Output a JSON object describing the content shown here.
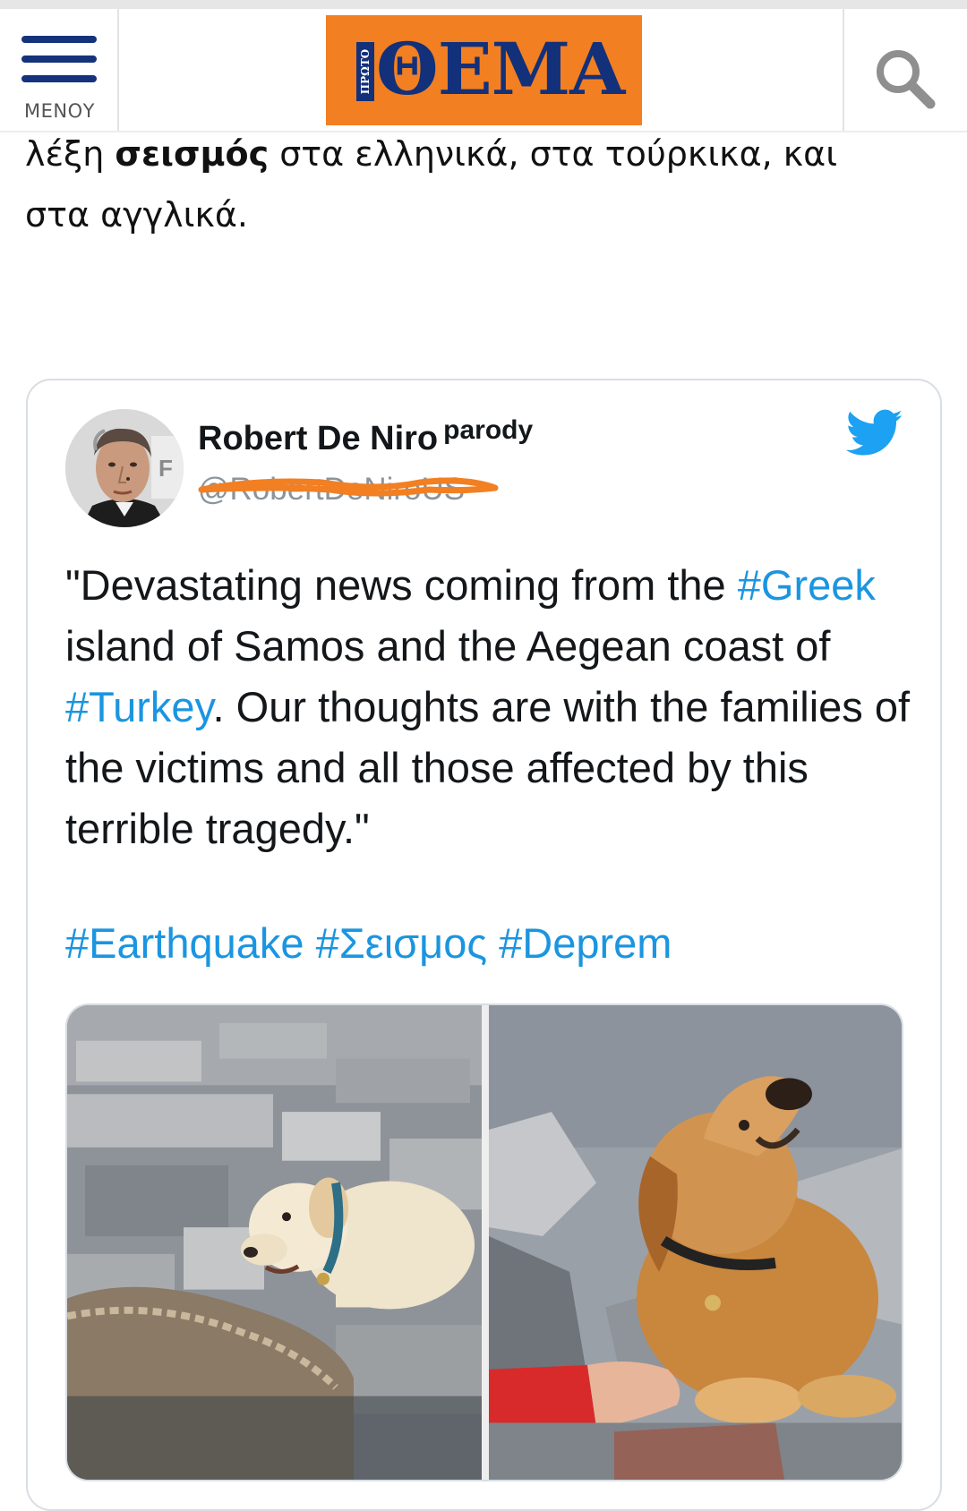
{
  "header": {
    "menu_label": "ΜΕΝΟΥ",
    "logo_prefix": "ΠΡΩΤΟ",
    "logo_word": "ΘΕΜΑ",
    "accent_color": "#f27f22",
    "brand_color": "#13307a",
    "icons": [
      "hamburger-icon",
      "search-icon"
    ]
  },
  "article": {
    "line1_before": "λέξη ",
    "line1_bold": "σεισμός",
    "line1_after": " στα ελληνικά, στα τούρκικα, και",
    "line2": "στα αγγλικά."
  },
  "tweet": {
    "author_name": "Robert De Niro",
    "author_tag": "parody",
    "author_handle": "@RobertDeNiroUS",
    "body_1": "\"Devastating news coming from the ",
    "hashtag_1": "#Greek",
    "body_2": " island of Samos and the Aegean coast of ",
    "hashtag_2": "#Turkey",
    "body_3": ". Our thoughts are with the families of the victims and all those affected by this terrible tragedy.\"",
    "tags": "#Earthquake #Σεισμος #Deprem",
    "hashtag_color": "#1b95e0",
    "icons": [
      "twitter-bird-icon"
    ]
  }
}
